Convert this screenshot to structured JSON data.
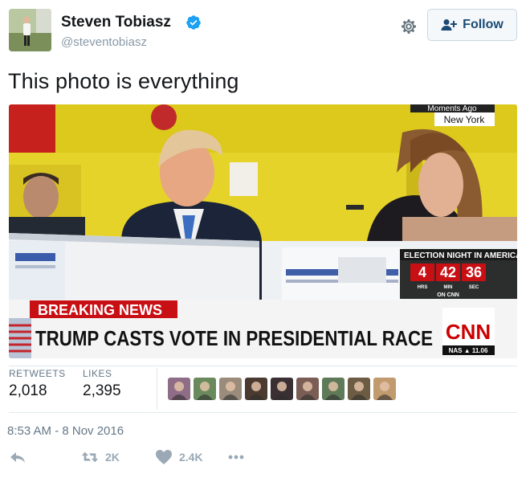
{
  "user": {
    "name": "Steven Tobiasz",
    "handle": "@steventobiasz",
    "verified": true,
    "follow_label": "Follow"
  },
  "tweet": {
    "text": "This photo is everything"
  },
  "media": {
    "chyron_top": "BREAKING NEWS",
    "chyron_main": "TRUMP CASTS VOTE IN PRESIDENTIAL RACE",
    "network": "CNN",
    "corner_line1": "Moments Ago",
    "corner_line2": "New York",
    "countdown_title": "ELECTION NIGHT IN AMERICA",
    "countdown_hrs": "4",
    "countdown_min": "42",
    "countdown_sec": "36",
    "countdown_hrs_label": "HRS",
    "countdown_min_label": "MIN",
    "countdown_sec_label": "SEC",
    "countdown_footer": "ON CNN",
    "ticker": "NAS ▲ 11.06"
  },
  "stats": {
    "retweets_label": "RETWEETS",
    "retweets_value": "2,018",
    "likes_label": "LIKES",
    "likes_value": "2,395"
  },
  "likers_colors": [
    "#8f6d86",
    "#6a8a5e",
    "#9a8b7a",
    "#4b3a2f",
    "#3a3034",
    "#7a5e56",
    "#5f7a58",
    "#6d5c44",
    "#c19a6e"
  ],
  "timestamp": "8:53 AM - 8 Nov 2016",
  "actions": {
    "retweet_count": "2K",
    "like_count": "2.4K"
  },
  "colors": {
    "link_blue": "#1b4a74",
    "muted": "#657786",
    "verified": "#1da1f2",
    "cnn_red": "#cc0000"
  }
}
